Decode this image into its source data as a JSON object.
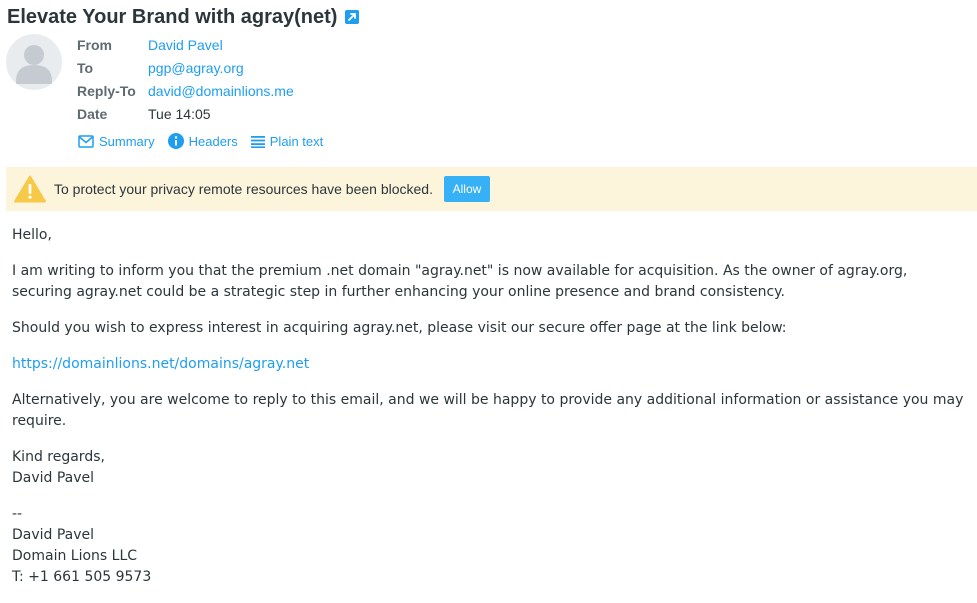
{
  "subject": "Elevate Your Brand with agray(net)",
  "headers": {
    "from": {
      "label": "From",
      "value": "David Pavel"
    },
    "to": {
      "label": "To",
      "value": "pgp@agray.org"
    },
    "reply_to": {
      "label": "Reply-To",
      "value": "david@domainlions.me"
    },
    "date": {
      "label": "Date",
      "value": "Tue 14:05"
    }
  },
  "view_modes": {
    "summary": "Summary",
    "headers": "Headers",
    "plain_text": "Plain text"
  },
  "remote_notice": {
    "text": "To protect your privacy remote resources have been blocked.",
    "allow_label": "Allow"
  },
  "body": {
    "greeting": "Hello,",
    "para1": "I am writing to inform you that the premium .net domain \"agray.net\" is now available for acquisition. As the owner of agray.org, securing agray.net could be a strategic step in further enhancing your online presence and brand consistency.",
    "para2": "Should you wish to express interest in acquiring agray.net, please visit our secure offer page at the link below:",
    "link": "https://domainlions.net/domains/agray.net",
    "para3": "Alternatively, you are welcome to reply to this email, and we will be happy to provide any additional information or assistance you may require.",
    "closing_1": "Kind regards,",
    "closing_2": "David Pavel",
    "sig_sep": "--",
    "sig_name": "David Pavel",
    "sig_company": "Domain Lions LLC",
    "sig_phone": "T: +1 661 505 9573"
  },
  "colors": {
    "accent": "#1f9ef0",
    "notice_bg": "#fcf5dc",
    "warning": "#f7c948",
    "allow_bg": "#37b1f5"
  },
  "icons": {
    "subject": "external-link-icon",
    "avatar": "user-avatar-icon",
    "summary": "envelope-icon",
    "headers": "info-icon",
    "plain_text": "list-icon",
    "notice": "warning-icon"
  }
}
